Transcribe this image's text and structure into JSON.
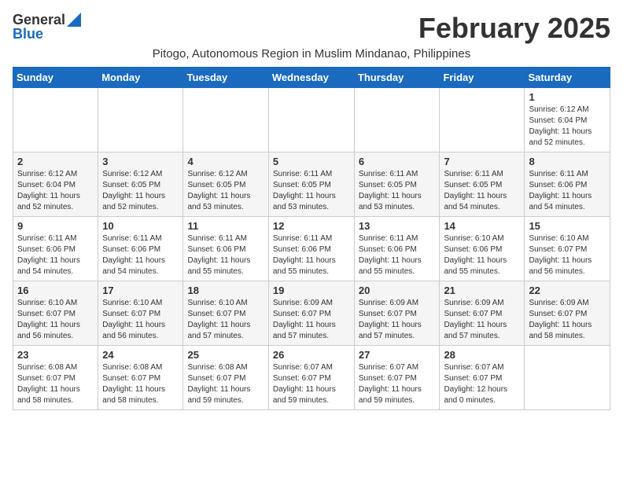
{
  "header": {
    "logo_general": "General",
    "logo_blue": "Blue",
    "month_title": "February 2025",
    "location": "Pitogo, Autonomous Region in Muslim Mindanao, Philippines"
  },
  "days_of_week": [
    "Sunday",
    "Monday",
    "Tuesday",
    "Wednesday",
    "Thursday",
    "Friday",
    "Saturday"
  ],
  "weeks": [
    [
      {
        "day": "",
        "info": ""
      },
      {
        "day": "",
        "info": ""
      },
      {
        "day": "",
        "info": ""
      },
      {
        "day": "",
        "info": ""
      },
      {
        "day": "",
        "info": ""
      },
      {
        "day": "",
        "info": ""
      },
      {
        "day": "1",
        "info": "Sunrise: 6:12 AM\nSunset: 6:04 PM\nDaylight: 11 hours\nand 52 minutes."
      }
    ],
    [
      {
        "day": "2",
        "info": "Sunrise: 6:12 AM\nSunset: 6:04 PM\nDaylight: 11 hours\nand 52 minutes."
      },
      {
        "day": "3",
        "info": "Sunrise: 6:12 AM\nSunset: 6:05 PM\nDaylight: 11 hours\nand 52 minutes."
      },
      {
        "day": "4",
        "info": "Sunrise: 6:12 AM\nSunset: 6:05 PM\nDaylight: 11 hours\nand 53 minutes."
      },
      {
        "day": "5",
        "info": "Sunrise: 6:11 AM\nSunset: 6:05 PM\nDaylight: 11 hours\nand 53 minutes."
      },
      {
        "day": "6",
        "info": "Sunrise: 6:11 AM\nSunset: 6:05 PM\nDaylight: 11 hours\nand 53 minutes."
      },
      {
        "day": "7",
        "info": "Sunrise: 6:11 AM\nSunset: 6:05 PM\nDaylight: 11 hours\nand 54 minutes."
      },
      {
        "day": "8",
        "info": "Sunrise: 6:11 AM\nSunset: 6:06 PM\nDaylight: 11 hours\nand 54 minutes."
      }
    ],
    [
      {
        "day": "9",
        "info": "Sunrise: 6:11 AM\nSunset: 6:06 PM\nDaylight: 11 hours\nand 54 minutes."
      },
      {
        "day": "10",
        "info": "Sunrise: 6:11 AM\nSunset: 6:06 PM\nDaylight: 11 hours\nand 54 minutes."
      },
      {
        "day": "11",
        "info": "Sunrise: 6:11 AM\nSunset: 6:06 PM\nDaylight: 11 hours\nand 55 minutes."
      },
      {
        "day": "12",
        "info": "Sunrise: 6:11 AM\nSunset: 6:06 PM\nDaylight: 11 hours\nand 55 minutes."
      },
      {
        "day": "13",
        "info": "Sunrise: 6:11 AM\nSunset: 6:06 PM\nDaylight: 11 hours\nand 55 minutes."
      },
      {
        "day": "14",
        "info": "Sunrise: 6:10 AM\nSunset: 6:06 PM\nDaylight: 11 hours\nand 55 minutes."
      },
      {
        "day": "15",
        "info": "Sunrise: 6:10 AM\nSunset: 6:07 PM\nDaylight: 11 hours\nand 56 minutes."
      }
    ],
    [
      {
        "day": "16",
        "info": "Sunrise: 6:10 AM\nSunset: 6:07 PM\nDaylight: 11 hours\nand 56 minutes."
      },
      {
        "day": "17",
        "info": "Sunrise: 6:10 AM\nSunset: 6:07 PM\nDaylight: 11 hours\nand 56 minutes."
      },
      {
        "day": "18",
        "info": "Sunrise: 6:10 AM\nSunset: 6:07 PM\nDaylight: 11 hours\nand 57 minutes."
      },
      {
        "day": "19",
        "info": "Sunrise: 6:09 AM\nSunset: 6:07 PM\nDaylight: 11 hours\nand 57 minutes."
      },
      {
        "day": "20",
        "info": "Sunrise: 6:09 AM\nSunset: 6:07 PM\nDaylight: 11 hours\nand 57 minutes."
      },
      {
        "day": "21",
        "info": "Sunrise: 6:09 AM\nSunset: 6:07 PM\nDaylight: 11 hours\nand 57 minutes."
      },
      {
        "day": "22",
        "info": "Sunrise: 6:09 AM\nSunset: 6:07 PM\nDaylight: 11 hours\nand 58 minutes."
      }
    ],
    [
      {
        "day": "23",
        "info": "Sunrise: 6:08 AM\nSunset: 6:07 PM\nDaylight: 11 hours\nand 58 minutes."
      },
      {
        "day": "24",
        "info": "Sunrise: 6:08 AM\nSunset: 6:07 PM\nDaylight: 11 hours\nand 58 minutes."
      },
      {
        "day": "25",
        "info": "Sunrise: 6:08 AM\nSunset: 6:07 PM\nDaylight: 11 hours\nand 59 minutes."
      },
      {
        "day": "26",
        "info": "Sunrise: 6:07 AM\nSunset: 6:07 PM\nDaylight: 11 hours\nand 59 minutes."
      },
      {
        "day": "27",
        "info": "Sunrise: 6:07 AM\nSunset: 6:07 PM\nDaylight: 11 hours\nand 59 minutes."
      },
      {
        "day": "28",
        "info": "Sunrise: 6:07 AM\nSunset: 6:07 PM\nDaylight: 12 hours\nand 0 minutes."
      },
      {
        "day": "",
        "info": ""
      }
    ]
  ]
}
